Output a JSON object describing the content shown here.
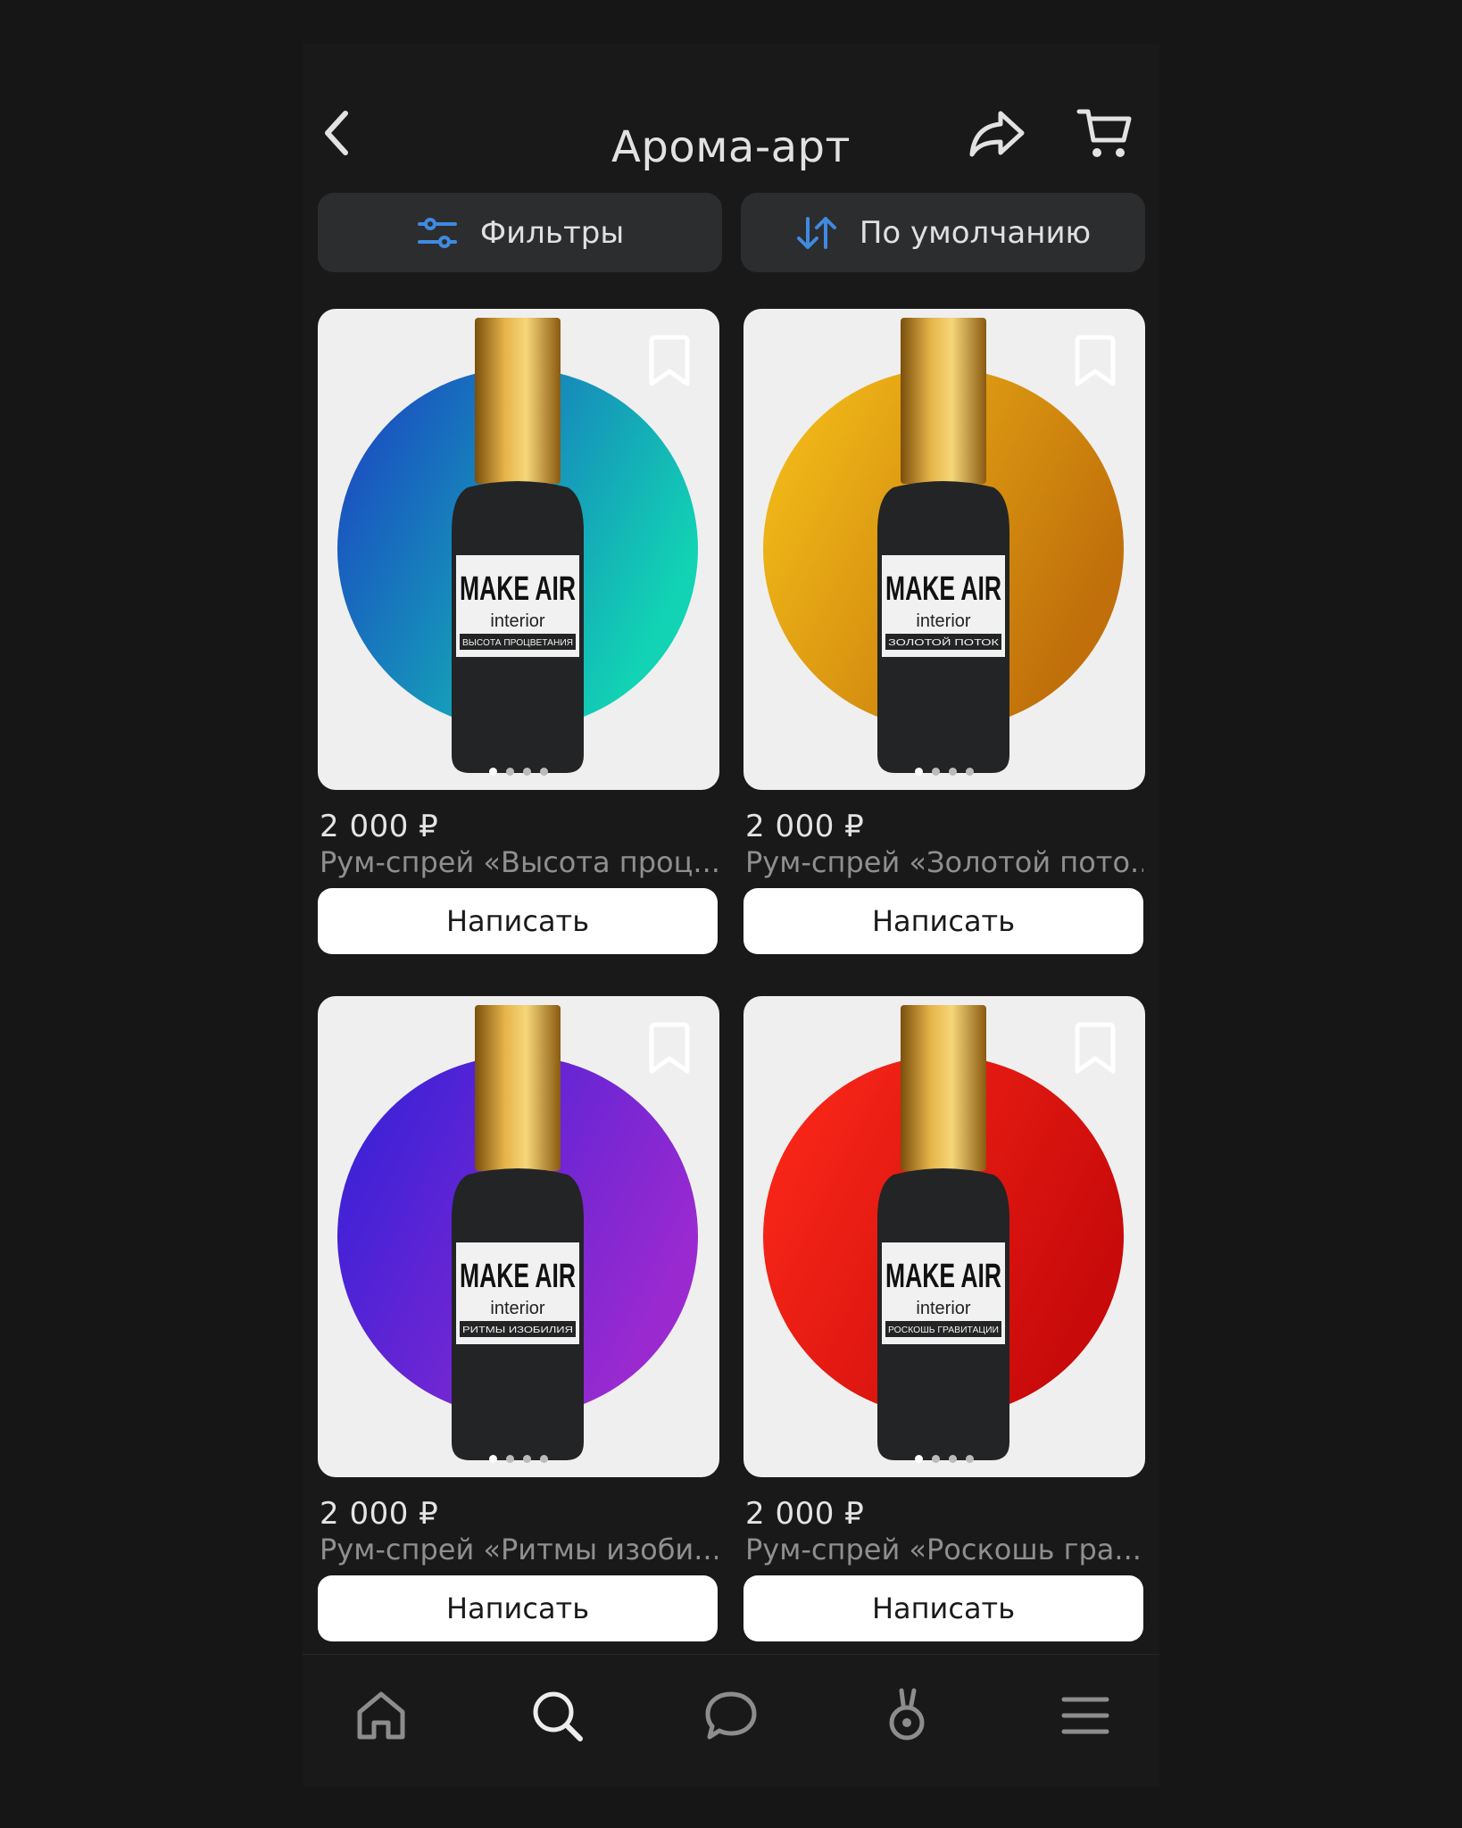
{
  "header": {
    "title": "Арома-арт",
    "back_icon": "back-arrow-icon",
    "share_icon": "share-icon",
    "cart_icon": "cart-icon"
  },
  "toolbar": {
    "filters_label": "Фильтры",
    "sort_label": "По умолчанию"
  },
  "colors": {
    "accent": "#3f8ae0",
    "background": "#191919",
    "card_bg": "#efefef"
  },
  "products": [
    {
      "price": "2 000 ₽",
      "name": "Рум-спрей «Высота проц...",
      "button": "Написать",
      "brand": "MAKE AIR",
      "sub": "interior",
      "scent": "ВЫСОТА ПРОЦВЕТАНИЯ",
      "gradient": [
        "#1b3fc2",
        "#12d3b4"
      ]
    },
    {
      "price": "2 000 ₽",
      "name": "Рум-спрей «Золотой пото...",
      "button": "Написать",
      "brand": "MAKE AIR",
      "sub": "interior",
      "scent": "ЗОЛОТОЙ ПОТОК",
      "gradient": [
        "#f7c21a",
        "#c06f0a"
      ]
    },
    {
      "price": "2 000 ₽",
      "name": "Рум-спрей «Ритмы изоби...",
      "button": "Написать",
      "brand": "MAKE AIR",
      "sub": "interior",
      "scent": "РИТМЫ ИЗОБИЛИЯ",
      "gradient": [
        "#3020d8",
        "#9a2ad0"
      ]
    },
    {
      "price": "2 000 ₽",
      "name": "Рум-спрей «Роскошь гра...",
      "button": "Написать",
      "brand": "MAKE AIR",
      "sub": "interior",
      "scent": "РОСКОШЬ ГРАВИТАЦИИ",
      "gradient": [
        "#ff2a1a",
        "#c80a0a"
      ]
    }
  ],
  "tabbar": {
    "items": [
      "home-icon",
      "search-icon",
      "chat-icon",
      "clips-icon",
      "menu-icon"
    ],
    "active": "search-icon"
  }
}
